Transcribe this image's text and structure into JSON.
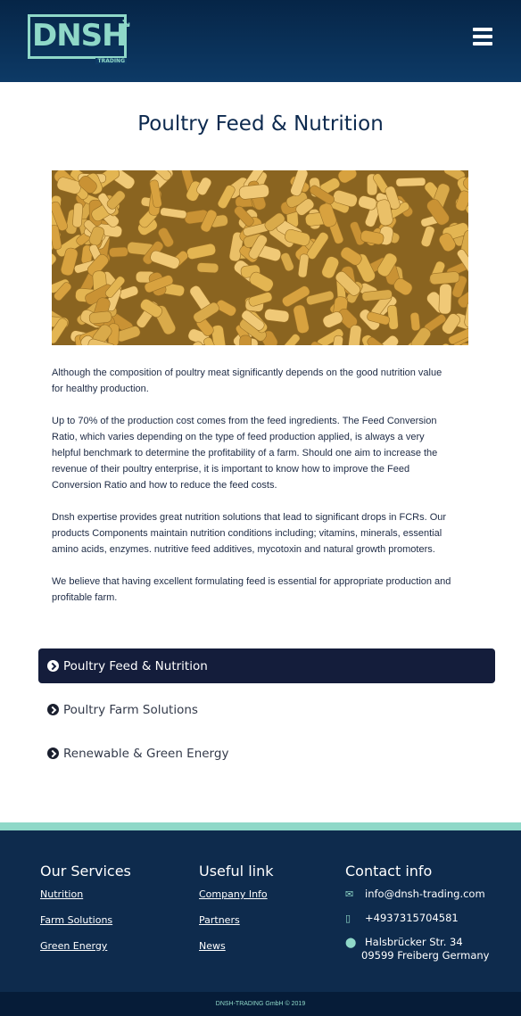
{
  "header": {
    "logo_text": "DNSH",
    "logo_subtext": "TRADING",
    "menu_icon": "hamburger-menu-icon"
  },
  "page": {
    "title": "Poultry Feed & Nutrition",
    "image_alt": "poultry feed pellets"
  },
  "content": {
    "paragraphs": [
      "Although the composition of poultry meat significantly depends on the good nutrition value for healthy production.",
      "Up to 70% of the production cost comes from the feed ingredients. The Feed Conversion Ratio, which varies depending on the type of feed production applied, is always a very helpful benchmark to determine the profitability of a farm. Should one aim to increase the revenue of their poultry enterprise, it is important to know how to improve the Feed Conversion Ratio and how to reduce the feed costs.",
      "Dnsh expertise provides great nutrition solutions that lead to significant drops in FCRs. Our products Components maintain nutrition conditions including; vitamins, minerals, essential amino acids, enzymes. nutritive feed additives, mycotoxin and natural growth promoters.",
      "We believe that having excellent formulating feed is essential for appropriate production and profitable farm."
    ]
  },
  "accordion": {
    "items": [
      {
        "label": "Poultry Feed & Nutrition",
        "active": true
      },
      {
        "label": "Poultry Farm Solutions",
        "active": false
      },
      {
        "label": "Renewable & Green Energy",
        "active": false
      }
    ]
  },
  "footer": {
    "services": {
      "heading": "Our Services",
      "links": [
        "Nutrition",
        "Farm Solutions",
        "Green Energy"
      ]
    },
    "useful": {
      "heading": "Useful link",
      "links": [
        "Company Info",
        "Partners",
        "News"
      ]
    },
    "contact": {
      "heading": "Contact info",
      "email": "info@dnsh-trading.com",
      "phone": "+4937315704581",
      "address_line1": "Halsbrücker Str. 34",
      "address_line2": "09599 Freiberg Germany"
    },
    "copyright": "DNSH-TRADING GmbH © 2019"
  },
  "colors": {
    "header_bg": "#0d3a66",
    "accent": "#8fd8c8",
    "active_tab": "#141d3b",
    "footer_bg": "#0e2b4d"
  }
}
